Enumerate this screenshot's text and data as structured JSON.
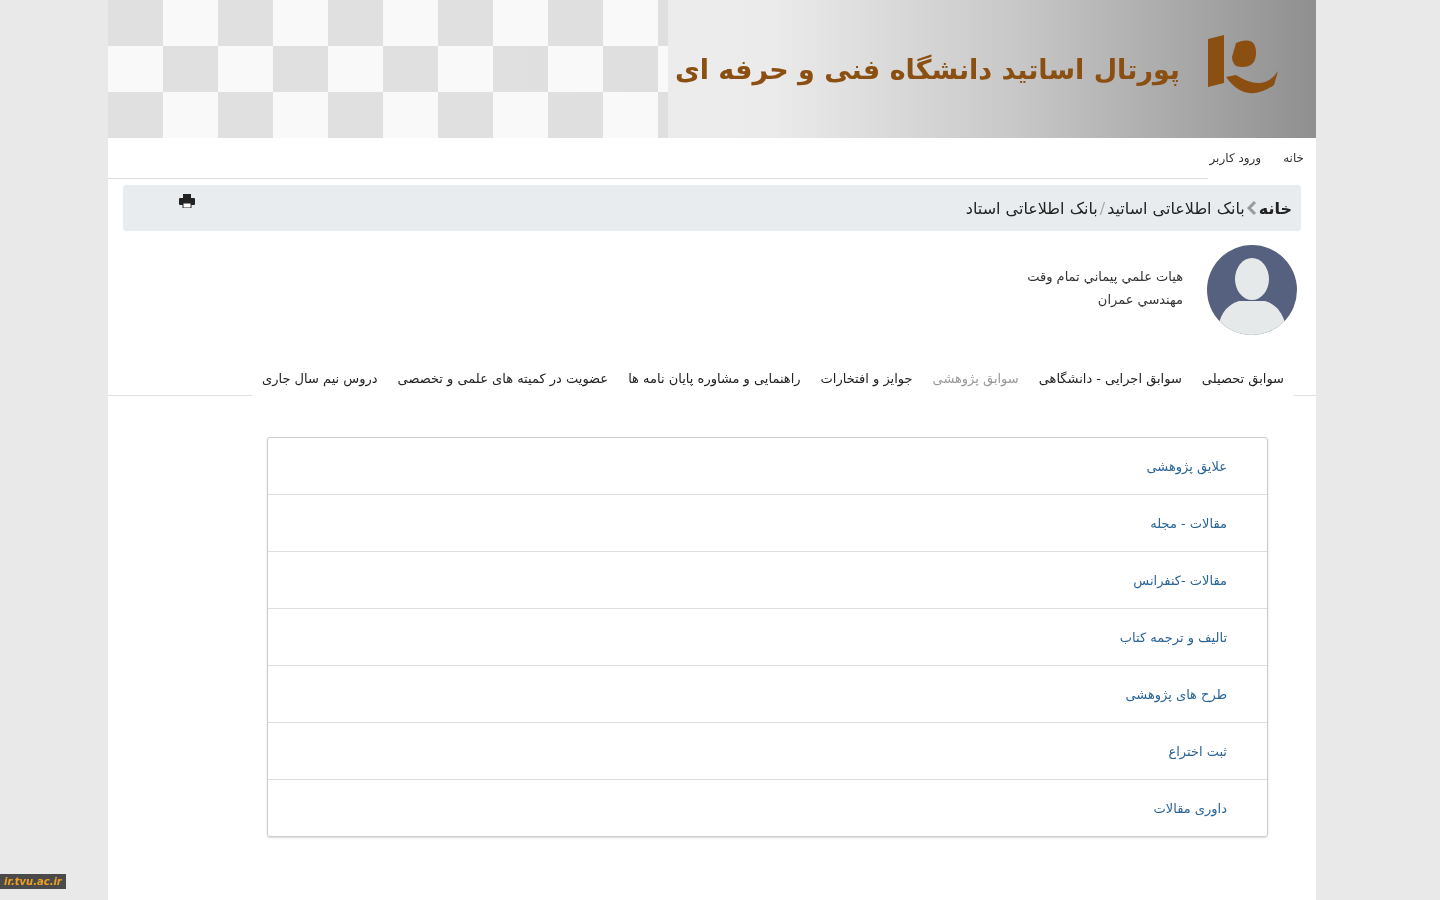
{
  "banner": {
    "title": "پورتال اساتید دانشگاه فنی و حرفه ای"
  },
  "nav": [
    "خانه",
    "ورود کاربر"
  ],
  "breadcrumb": {
    "home": "خانه",
    "parent": "بانک اطلاعاتی اساتید",
    "separator": "/",
    "current": "بانک اطلاعاتی استاد"
  },
  "profile": {
    "lines": [
      "هيات علمي پيماني تمام وقت",
      "مهندسي عمران"
    ]
  },
  "tabs": [
    {
      "label": "سوابق تحصیلی",
      "selected": false
    },
    {
      "label": "سوابق اجرایی - دانشگاهی",
      "selected": false
    },
    {
      "label": "سوابق پژوهشی",
      "selected": true
    },
    {
      "label": "جوایز و افتخارات",
      "selected": false
    },
    {
      "label": "راهنمایی و مشاوره پایان نامه ها",
      "selected": false
    },
    {
      "label": "عضویت در کمیته های علمی و تخصصی",
      "selected": false
    },
    {
      "label": "دروس نیم سال جاری",
      "selected": false
    }
  ],
  "sections": [
    "علایق پژوهشی",
    "مقالات - مجله",
    "مقالات -کنفرانس",
    "تالیف و ترجمه کتاب",
    "طرح های پژوهشی",
    "ثبت اختراع",
    "داوری مقالات"
  ],
  "footer_badge": "ir.tvu.ac.ir"
}
